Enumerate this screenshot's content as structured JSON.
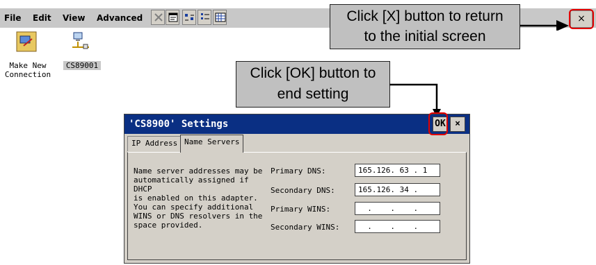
{
  "menu": {
    "file": "File",
    "edit": "Edit",
    "view": "View",
    "advanced": "Advanced"
  },
  "toolbar_icons": [
    "delete-icon",
    "properties-icon",
    "large-icons-icon",
    "small-icons-icon",
    "details-icon"
  ],
  "close_top": "×",
  "desktop": {
    "make_new_line1": "Make New",
    "make_new_line2": "Connection",
    "cs89001": "CS89001"
  },
  "callouts": {
    "close_line1": "Click [X] button to return",
    "close_line2": "to the initial screen",
    "ok_line1": "Click [OK] button to",
    "ok_line2": "end setting"
  },
  "dialog": {
    "title": "'CS8900' Settings",
    "ok": "OK",
    "close": "×",
    "tabs": [
      "IP Address",
      "Name Servers"
    ],
    "description": [
      "Name server addresses may be",
      "automatically assigned if DHCP",
      "is enabled on this adapter.",
      "You can specify additional",
      "WINS or DNS resolvers in the",
      "space provided."
    ],
    "fields": {
      "primary_dns_label": "Primary DNS:",
      "primary_dns_value": "165.126. 63 . 1",
      "secondary_dns_label": "Secondary DNS:",
      "secondary_dns_value": "165.126. 34 .",
      "primary_wins_label": "Primary WINS:",
      "primary_wins_value": "  .    .    .",
      "secondary_wins_label": "Secondary WINS:",
      "secondary_wins_value": "  .    .    ."
    }
  }
}
